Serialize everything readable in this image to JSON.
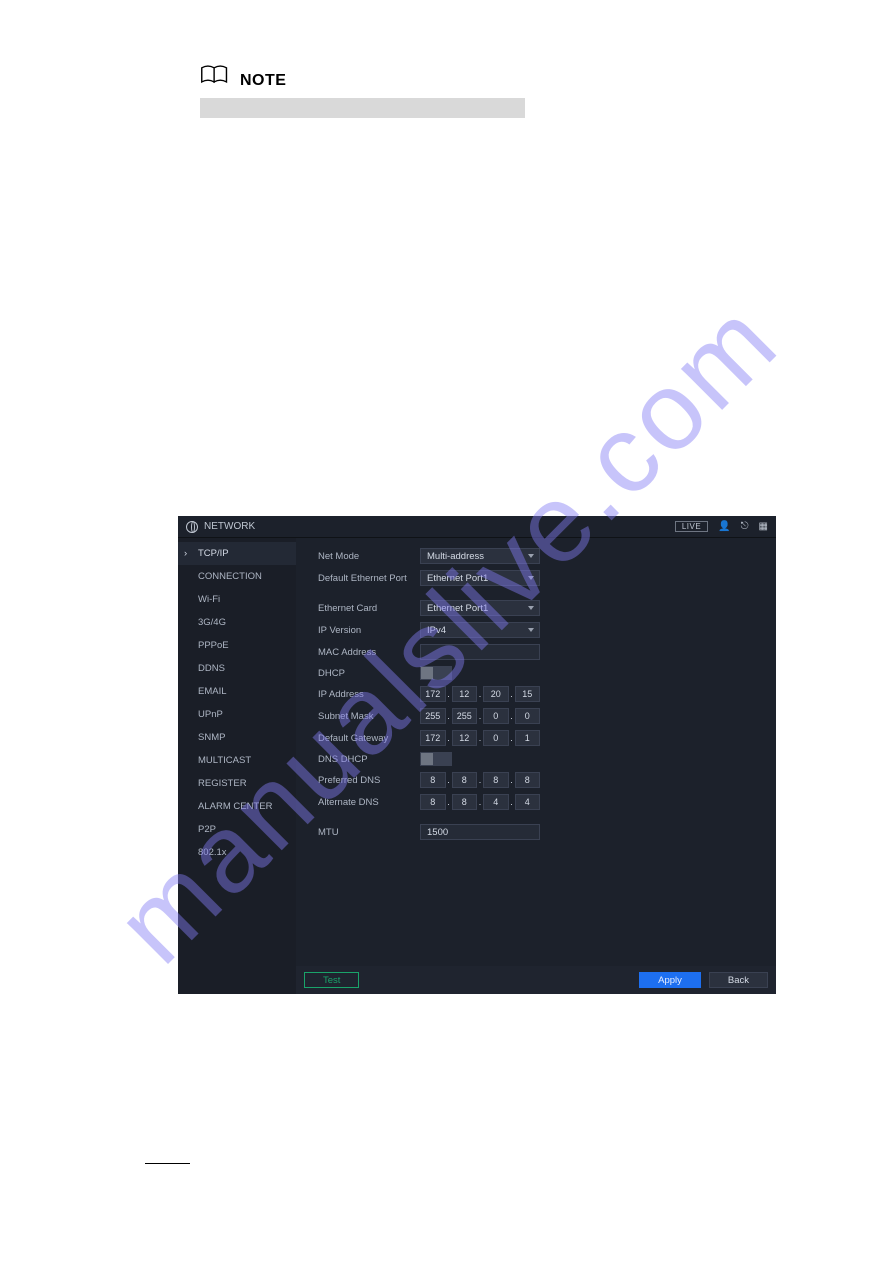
{
  "note": {
    "label": "NOTE"
  },
  "watermark": "manualslive.com",
  "shot": {
    "title": "NETWORK",
    "live": "LIVE",
    "sidebar": [
      "TCP/IP",
      "CONNECTION",
      "Wi-Fi",
      "3G/4G",
      "PPPoE",
      "DDNS",
      "EMAIL",
      "UPnP",
      "SNMP",
      "MULTICAST",
      "REGISTER",
      "ALARM CENTER",
      "P2P",
      "802.1x"
    ],
    "sidebar_active_index": 0,
    "labels": {
      "netMode": "Net Mode",
      "defaultPort": "Default Ethernet Port",
      "ethCard": "Ethernet Card",
      "ipVersion": "IP Version",
      "mac": "MAC Address",
      "dhcp": "DHCP",
      "ip": "IP Address",
      "mask": "Subnet Mask",
      "gateway": "Default Gateway",
      "dnsDhcp": "DNS DHCP",
      "pdns": "Preferred DNS",
      "adns": "Alternate DNS",
      "mtu": "MTU"
    },
    "values": {
      "netMode": "Multi-address",
      "defaultPort": "Ethernet Port1",
      "ethCard": "Ethernet Port1",
      "ipVersion": "IPv4",
      "mac": "",
      "ip": [
        "172",
        "12",
        "20",
        "15"
      ],
      "mask": [
        "255",
        "255",
        "0",
        "0"
      ],
      "gateway": [
        "172",
        "12",
        "0",
        "1"
      ],
      "pdns": [
        "8",
        "8",
        "8",
        "8"
      ],
      "adns": [
        "8",
        "8",
        "4",
        "4"
      ],
      "mtu": "1500"
    },
    "buttons": {
      "test": "Test",
      "apply": "Apply",
      "back": "Back"
    }
  }
}
